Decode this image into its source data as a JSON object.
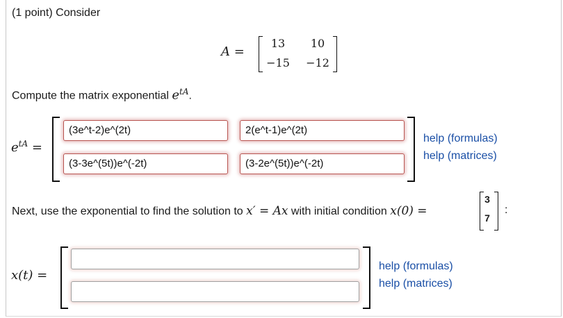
{
  "problem": {
    "intro": "(1 point) Consider",
    "matrix_lhs": "A =",
    "matrix_A": [
      [
        "13",
        "10"
      ],
      [
        "−15",
        "−12"
      ]
    ],
    "compute_text": "Compute the matrix exponential ",
    "compute_expr_base": "e",
    "compute_expr_exp": "tA",
    "compute_period": ".",
    "etA_lhs_base": "e",
    "etA_lhs_exp": "tA",
    "etA_lhs_eq": " =",
    "etA_answers": [
      [
        "(3e^t-2)e^(2t)",
        "2(e^t-1)e^(2t)"
      ],
      [
        "(3-3e^(5t))e^(-2t)",
        "(3-2e^(5t))e^(-2t)"
      ]
    ],
    "next_text_1": "Next, use the exponential to find the solution to ",
    "next_eq": "x′ = Ax",
    "next_text_2": " with initial condition ",
    "initial_expr": "x(0) =",
    "initial_vector": [
      "3",
      "7"
    ],
    "next_colon": ":",
    "xt_lhs": "x(t) =",
    "xt_answers": [
      "",
      ""
    ]
  },
  "help": {
    "formulas": "help (formulas)",
    "matrices": "help (matrices)"
  },
  "colors": {
    "link": "#1a4fa6",
    "answer_border": "#b85450"
  }
}
